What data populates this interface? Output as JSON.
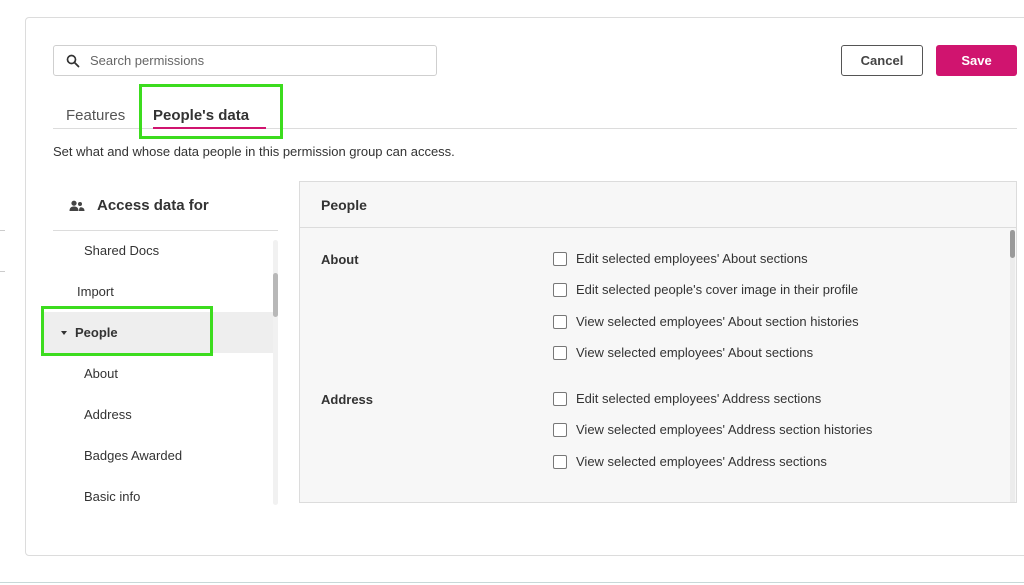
{
  "search": {
    "placeholder": "Search permissions",
    "value": ""
  },
  "actions": {
    "cancel_label": "Cancel",
    "save_label": "Save",
    "save_color": "#d0146f"
  },
  "tabs": [
    {
      "label": "Features",
      "active": false
    },
    {
      "label": "People's data",
      "active": true
    }
  ],
  "description": "Set what and whose data people in this permission group can access.",
  "access_header": {
    "label": "Access data for",
    "icon": "people-icon"
  },
  "left_nav": {
    "items": [
      {
        "label": "Shared Docs",
        "selected": false
      },
      {
        "label": "Import",
        "selected": false
      },
      {
        "label": "People",
        "selected": true,
        "expanded": true
      },
      {
        "label": "About",
        "selected": false
      },
      {
        "label": "Address",
        "selected": false
      },
      {
        "label": "Badges Awarded",
        "selected": false
      },
      {
        "label": "Basic info",
        "selected": false
      }
    ]
  },
  "panel": {
    "title": "People",
    "sections": [
      {
        "title": "About",
        "permissions": [
          "Edit selected employees' About sections",
          "Edit selected people's cover image in their profile",
          "View selected employees' About section histories",
          "View selected employees' About sections"
        ]
      },
      {
        "title": "Address",
        "permissions": [
          "Edit selected employees' Address sections",
          "View selected employees' Address section histories",
          "View selected employees' Address sections"
        ]
      }
    ]
  },
  "highlight_color": "#3cdc1e"
}
